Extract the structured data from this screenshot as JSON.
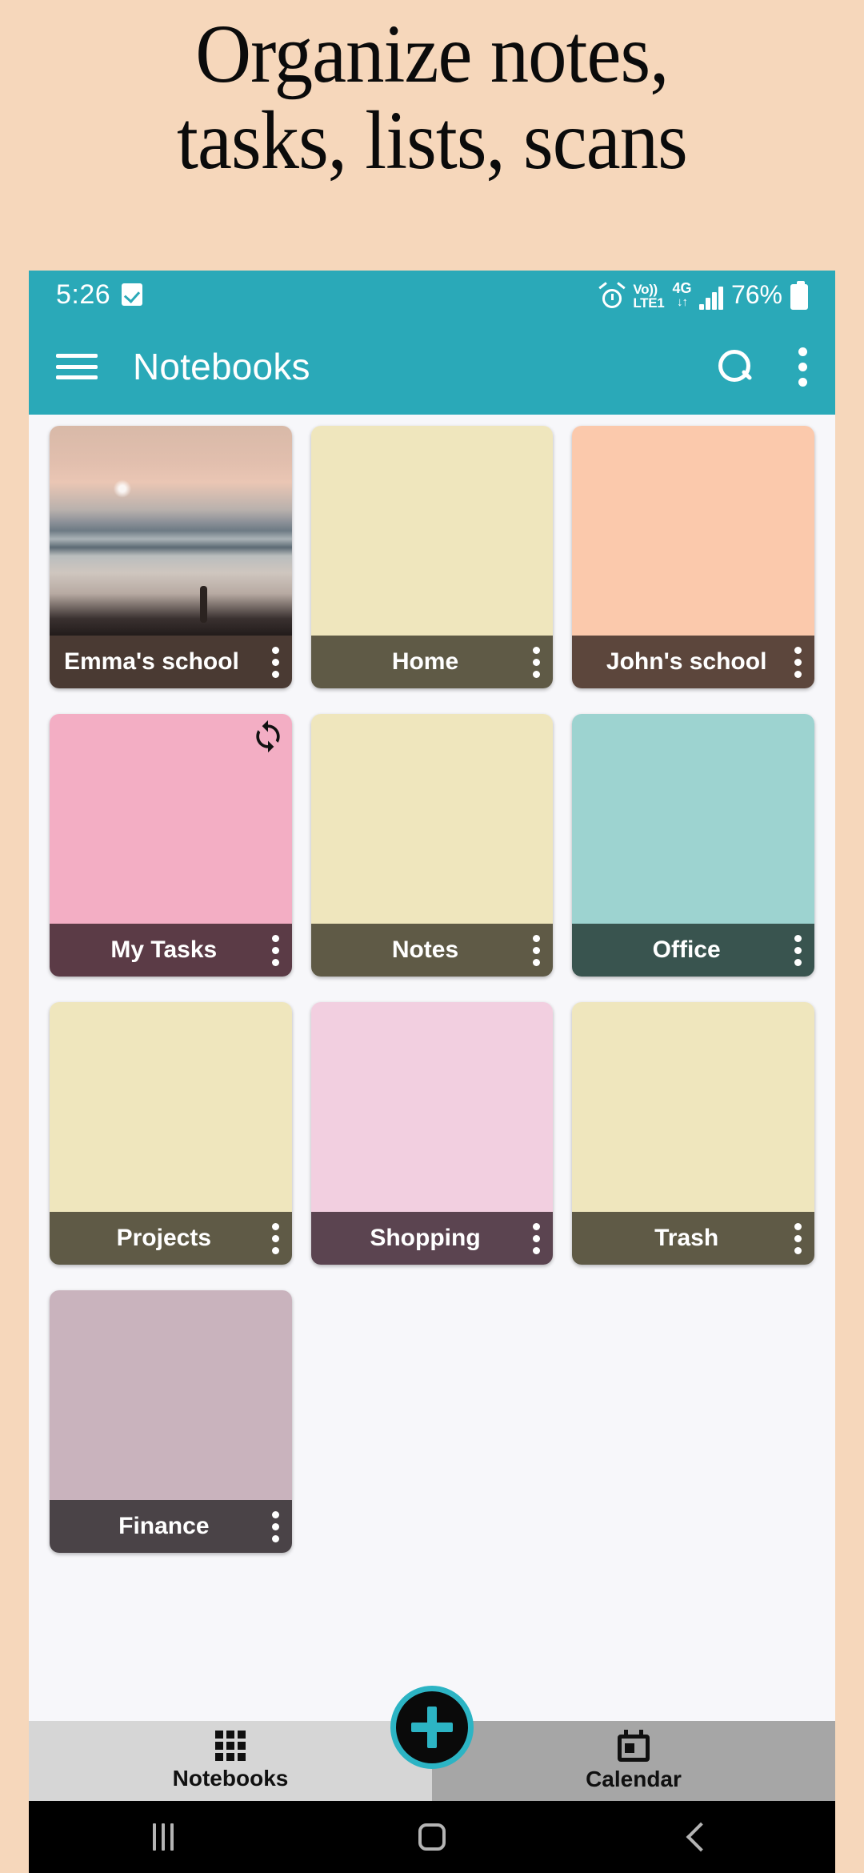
{
  "promo": {
    "line1": "Organize notes,",
    "line2": "tasks, lists, scans",
    "bg_color": "#f6d7bb"
  },
  "status_bar": {
    "time": "5:26",
    "check_icon": "checkbox-icon",
    "alarm_icon": "alarm-icon",
    "volte": "Vo))",
    "lte": "LTE1",
    "network": "4G",
    "arrows": "↓↑",
    "signal_icon": "signal-bars-icon",
    "battery_percent": "76%",
    "battery_icon": "battery-icon",
    "bg_color": "#2aa9b8"
  },
  "app_bar": {
    "menu_icon": "hamburger-menu-icon",
    "title": "Notebooks",
    "search_icon": "search-icon",
    "overflow_icon": "overflow-menu-icon",
    "bg_color": "#2aa9b8"
  },
  "notebooks": [
    {
      "name": "Emma's school",
      "body_color": "#c9a79a",
      "footer_color": "#4a3a33",
      "photo": true,
      "sync": false
    },
    {
      "name": "Home",
      "body_color": "#efe6bd",
      "footer_color": "#5f5a46",
      "photo": false,
      "sync": false
    },
    {
      "name": "John's school",
      "body_color": "#fbc9ac",
      "footer_color": "#5c463c",
      "photo": false,
      "sync": false
    },
    {
      "name": "My Tasks",
      "body_color": "#f3aec4",
      "footer_color": "#5b3b46",
      "photo": false,
      "sync": true
    },
    {
      "name": "Notes",
      "body_color": "#efe6bd",
      "footer_color": "#5f5a46",
      "photo": false,
      "sync": false
    },
    {
      "name": "Office",
      "body_color": "#9dd3d0",
      "footer_color": "#39544f",
      "photo": false,
      "sync": false
    },
    {
      "name": "Projects",
      "body_color": "#efe6bd",
      "footer_color": "#5f5a46",
      "photo": false,
      "sync": false
    },
    {
      "name": "Shopping",
      "body_color": "#f2cfe0",
      "footer_color": "#5b4450",
      "photo": false,
      "sync": false
    },
    {
      "name": "Trash",
      "body_color": "#efe6bd",
      "footer_color": "#5f5a46",
      "photo": false,
      "sync": false
    },
    {
      "name": "Finance",
      "body_color": "#c9b3bd",
      "footer_color": "#4a4347",
      "photo": false,
      "sync": false
    }
  ],
  "bottom_nav": {
    "tabs": [
      {
        "label": "Notebooks",
        "icon": "grid-icon",
        "active": true
      },
      {
        "label": "Calendar",
        "icon": "calendar-icon",
        "active": false
      }
    ],
    "fab": {
      "icon": "plus-icon",
      "ring_color": "#2cb4c4",
      "bg_color": "#0a0a0a"
    }
  },
  "android_nav": {
    "recents_icon": "recents-icon",
    "home_icon": "home-icon",
    "back_icon": "back-icon"
  }
}
